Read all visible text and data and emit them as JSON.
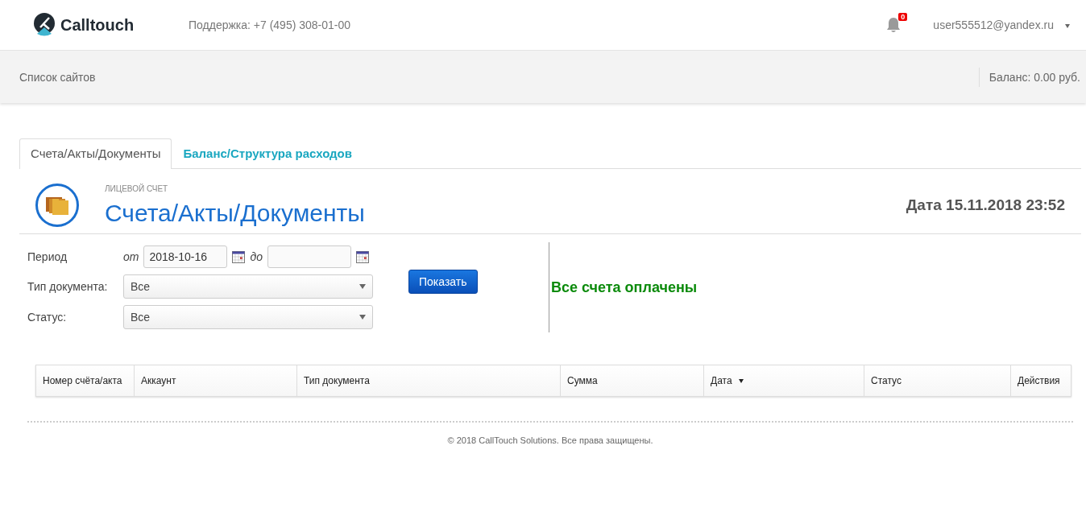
{
  "header": {
    "logo": "Calltouch",
    "support": "Поддержка: +7 (495) 308-01-00",
    "notifications": "0",
    "user": "user555512@yandex.ru"
  },
  "subbar": {
    "sites": "Список сайтов",
    "balance": "Баланс: 0.00 руб."
  },
  "tabs": [
    {
      "label": "Счета/Акты/Документы",
      "selected": true
    },
    {
      "label": "Баланс/Структура расходов",
      "selected": false
    }
  ],
  "section": {
    "caption": "ЛИЦЕВОЙ СЧЕТ",
    "title": "Счета/Акты/Документы",
    "date": "Дата 15.11.2018 23:52"
  },
  "filters": {
    "period_label": "Период",
    "from_label": "от",
    "from_value": "2018-10-16",
    "to_label": "до",
    "doc_type_label": "Тип документа:",
    "doc_type_value": "Все",
    "status_label": "Статус:",
    "status_value": "Все",
    "button": "Показать"
  },
  "status_message": "Все счета оплачены",
  "table": {
    "columns": [
      {
        "label": "Номер счёта/акта",
        "sorted": false
      },
      {
        "label": "Аккаунт",
        "sorted": false
      },
      {
        "label": "Тип документа",
        "sorted": false
      },
      {
        "label": "Сумма",
        "sorted": false
      },
      {
        "label": "Дата",
        "sorted": true
      },
      {
        "label": "Статус",
        "sorted": false
      },
      {
        "label": "Действия",
        "sorted": false
      }
    ]
  },
  "footer": "© 2018 CallTouch Solutions. Все права защищены."
}
